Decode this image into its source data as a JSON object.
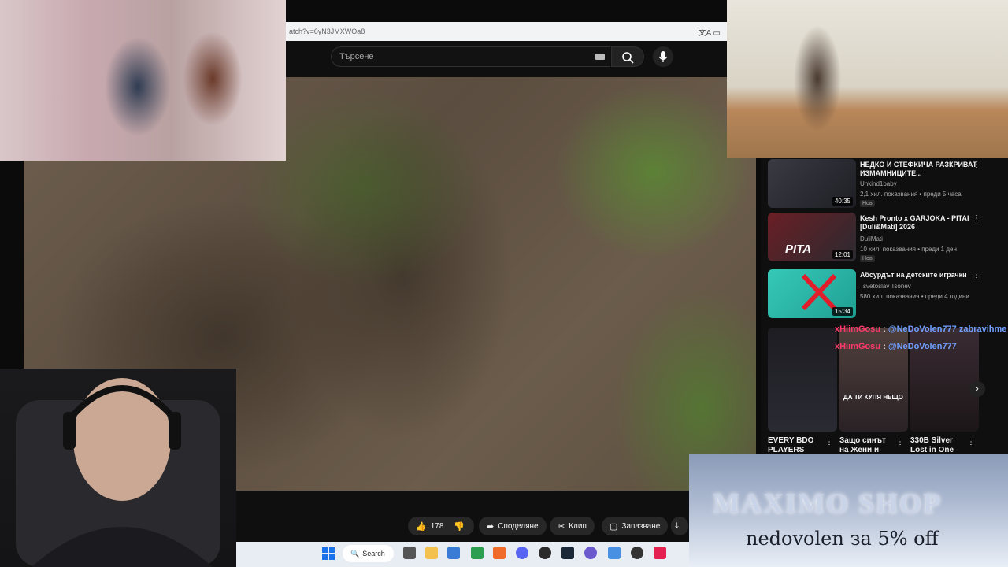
{
  "browser": {
    "url_fragment": "atch?v=6yN3JMXWOa8",
    "search_placeholder": "Търсене"
  },
  "video_actions": {
    "likes": "178",
    "share": "Споделяне",
    "clip": "Клип",
    "save": "Запазване"
  },
  "recommendations": [
    {
      "title": "НЕДКО И СТЕФКИЧА РАЗКРИВАТ ИЗМАМНИЦИТЕ...",
      "channel": "Unkind1baby",
      "meta": "2,1 хил. показвания • преди 5 часа",
      "badge": "Нов",
      "duration": "40:35",
      "thumb_color": "#2a2a30"
    },
    {
      "title": "Kesh Pronto x GARJOKA - PITAI [Duli&Mati] 2026",
      "channel": "DuliMati",
      "meta": "10 хил. показвания • преди 1 ден",
      "badge": "Нов",
      "duration": "12:01",
      "thumb_label": "PITA",
      "thumb_color": "#8a2a30"
    },
    {
      "title": "Абсурдът на детските играчки",
      "channel": "Tsvetoslav Tsonev",
      "meta": "580 хил. показвания • преди 4 години",
      "badge": "",
      "duration": "15:34",
      "thumb_color": "#2fbfb0"
    }
  ],
  "shorts": [
    {
      "title": "EVERY BDO PLAYERS"
    },
    {
      "title": "Защо синът на Жени и"
    },
    {
      "title": "330B Silver Lost in One"
    }
  ],
  "chat": [
    {
      "user": "xHiimGosu",
      "sep": " : ",
      "text": "@NeDoVolen777 zabravihme"
    },
    {
      "user": "xHiimGosu",
      "sep": " : ",
      "text": "@NeDoVolen777"
    }
  ],
  "overlay_caption": "ДА ТИ КУПЯ НЕЩО",
  "banner": {
    "brand": "MAXIMO SHOP",
    "promo": "nedovolen за 5% off"
  },
  "taskbar": {
    "search_label": "Search"
  }
}
